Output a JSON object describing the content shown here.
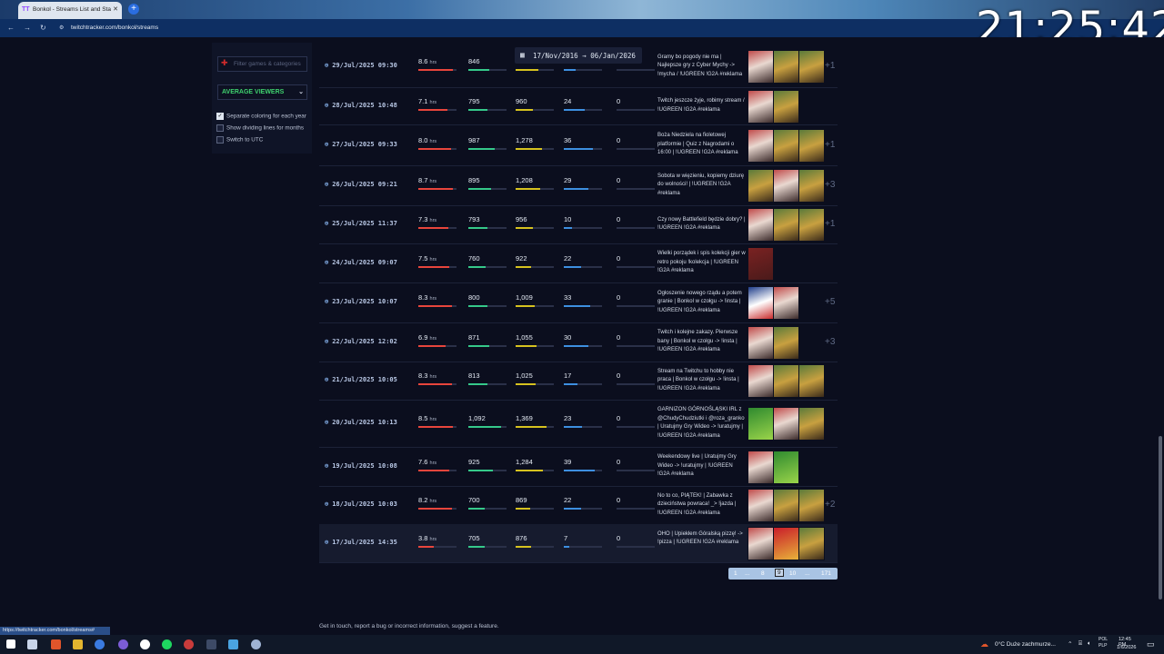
{
  "browser": {
    "tab_title": "Bonkol - Streams List and Stats",
    "tab_icon": "twitchtracker-icon",
    "url": "twitchtracker.com/bonkol/streams",
    "status_url": "https://twitchtracker.com/bonkol/streams#"
  },
  "overlay_clock": "21:25:42",
  "sidebar": {
    "filter_placeholder": "Filter games & categories",
    "metric_select": "AVERAGE VIEWERS",
    "options": [
      {
        "label": "Separate coloring for each year",
        "checked": true
      },
      {
        "label": "Show dividing lines for months",
        "checked": false
      },
      {
        "label": "Switch to UTC",
        "checked": false
      }
    ]
  },
  "date_range": "17/Nov/2016 → 06/Jan/2026",
  "colors": {
    "hours": "#e8453c",
    "avg": "#35c98a",
    "peak": "#d6c21f",
    "followers": "#3d8fe0"
  },
  "streams": [
    {
      "date": "29/Jul/2025 09:30",
      "hours": "8.6",
      "avg": "846",
      "peak": "",
      "followers": "",
      "views": "",
      "title": "Gramy bo pogody nie ma | Najlepsze gry z Cyber Mychy -> !mycha / !UGREEN !G2A #reklama",
      "thumbs": [
        "justchatting",
        "game",
        "game"
      ],
      "more": "+1",
      "bars": {
        "h": 0.9,
        "a": 0.55,
        "p": 0.6,
        "f": 0.3
      }
    },
    {
      "date": "28/Jul/2025 10:48",
      "hours": "7.1",
      "avg": "795",
      "peak": "960",
      "followers": "24",
      "views": "0",
      "title": "Twitch jeszcze żyje, robimy stream / !UGREEN !G2A #reklama",
      "thumbs": [
        "justchatting",
        "game"
      ],
      "more": "",
      "bars": {
        "h": 0.75,
        "a": 0.5,
        "p": 0.45,
        "f": 0.55
      }
    },
    {
      "date": "27/Jul/2025 09:33",
      "hours": "8.0",
      "avg": "987",
      "peak": "1,278",
      "followers": "36",
      "views": "0",
      "title": "Boża Niedziela na fioletowej platformie | Quiz z Nagrodami o 16:00 | !UGREEN !G2A #reklama",
      "thumbs": [
        "justchatting",
        "game",
        "game"
      ],
      "more": "+1",
      "bars": {
        "h": 0.85,
        "a": 0.7,
        "p": 0.7,
        "f": 0.75
      }
    },
    {
      "date": "26/Jul/2025 09:21",
      "hours": "8.7",
      "avg": "895",
      "peak": "1,208",
      "followers": "29",
      "views": "0",
      "title": "Sobota w więzieniu, kopiemy dziurę do wolności! | !UGREEN !G2A #reklama",
      "thumbs": [
        "game",
        "justchatting",
        "game"
      ],
      "more": "+3",
      "bars": {
        "h": 0.9,
        "a": 0.6,
        "p": 0.65,
        "f": 0.65
      }
    },
    {
      "date": "25/Jul/2025 11:37",
      "hours": "7.3",
      "avg": "793",
      "peak": "956",
      "followers": "10",
      "views": "0",
      "title": "Czy nowy Battlefield będzie dobry? | !UGREEN !G2A #reklama",
      "thumbs": [
        "justchatting",
        "game",
        "game"
      ],
      "more": "+1",
      "bars": {
        "h": 0.78,
        "a": 0.5,
        "p": 0.45,
        "f": 0.22
      }
    },
    {
      "date": "24/Jul/2025 09:07",
      "hours": "7.5",
      "avg": "760",
      "peak": "922",
      "followers": "22",
      "views": "0",
      "title": "Wielki porządek i spis kolekcji gier w retro pokoju !kolekcja | !UGREEN !G2A #reklama",
      "thumbs": [
        "retro"
      ],
      "more": "",
      "bars": {
        "h": 0.8,
        "a": 0.45,
        "p": 0.4,
        "f": 0.45
      }
    },
    {
      "date": "23/Jul/2025 10:07",
      "hours": "8.3",
      "avg": "800",
      "peak": "1,009",
      "followers": "33",
      "views": "0",
      "title": "Ogłoszenie nowego rządu a potem granie | Bonkol w czołgu -> !insta | !UGREEN !G2A #reklama",
      "thumbs": [
        "politics",
        "justchatting"
      ],
      "more": "+5",
      "bars": {
        "h": 0.88,
        "a": 0.5,
        "p": 0.5,
        "f": 0.7
      }
    },
    {
      "date": "22/Jul/2025 12:02",
      "hours": "6.9",
      "avg": "871",
      "peak": "1,055",
      "followers": "30",
      "views": "0",
      "title": "Twitch i kolejne zakazy. Pierwsze bany | Bonkol w czołgu -> !insta | !UGREEN !G2A #reklama",
      "thumbs": [
        "justchatting",
        "game"
      ],
      "more": "+3",
      "bars": {
        "h": 0.72,
        "a": 0.55,
        "p": 0.55,
        "f": 0.65
      }
    },
    {
      "date": "21/Jul/2025 10:05",
      "hours": "8.3",
      "avg": "813",
      "peak": "1,025",
      "followers": "17",
      "views": "0",
      "title": "Stream na Twitchu to hobby nie praca | Bonkol w czołgu -> !insta | !UGREEN !G2A #reklama",
      "thumbs": [
        "justchatting",
        "game",
        "game"
      ],
      "more": "",
      "bars": {
        "h": 0.88,
        "a": 0.5,
        "p": 0.52,
        "f": 0.35
      }
    },
    {
      "date": "20/Jul/2025 10:13",
      "hours": "8.5",
      "avg": "1,092",
      "peak": "1,369",
      "followers": "23",
      "views": "0",
      "title": "GARNIZON GÓRNOŚLĄSKI IRL z @ChudyChudziutki i @roza_granko | Uratujmy Gry Wideo -> !uratujmy | !UGREEN !G2A #reklama",
      "thumbs": [
        "irl",
        "justchatting",
        "game"
      ],
      "more": "",
      "bars": {
        "h": 0.9,
        "a": 0.85,
        "p": 0.8,
        "f": 0.48
      }
    },
    {
      "date": "19/Jul/2025 10:08",
      "hours": "7.6",
      "avg": "925",
      "peak": "1,284",
      "followers": "39",
      "views": "0",
      "title": "Weekendowy live | Uratujmy Gry Wideo -> !uratujmy | !UGREEN !G2A #reklama",
      "thumbs": [
        "justchatting",
        "irl"
      ],
      "more": "",
      "bars": {
        "h": 0.8,
        "a": 0.65,
        "p": 0.72,
        "f": 0.82
      }
    },
    {
      "date": "18/Jul/2025 10:03",
      "hours": "8.2",
      "avg": "700",
      "peak": "869",
      "followers": "22",
      "views": "0",
      "title": "No to co, PIĄTEK! | Zabawka z dzieciństwa powraca! _> !jazda | !UGREEN !G2A #reklama",
      "thumbs": [
        "justchatting",
        "game",
        "game"
      ],
      "more": "+2",
      "bars": {
        "h": 0.87,
        "a": 0.42,
        "p": 0.38,
        "f": 0.45
      }
    },
    {
      "date": "17/Jul/2025 14:35",
      "hours": "3.8",
      "avg": "705",
      "peak": "876",
      "followers": "7",
      "views": "0",
      "title": "OHO | Upiekłem Góralską pizzę! -> !pizza | !UGREEN !G2A #reklama",
      "thumbs": [
        "justchatting",
        "food",
        "game"
      ],
      "more": "",
      "bars": {
        "h": 0.4,
        "a": 0.43,
        "p": 0.4,
        "f": 0.15
      }
    }
  ],
  "hrs_unit": "hrs",
  "pagination": [
    "1",
    "...",
    "8",
    "9",
    "10",
    "...",
    "171"
  ],
  "pagination_current": "9",
  "footer": "Get in touch, report a bug or incorrect information, suggest a feature.",
  "tray": {
    "weather": "0°C  Duże zachmurze...",
    "lang": "POL\nPLP",
    "time": "12:45 PM",
    "date": "1/6/2026"
  }
}
